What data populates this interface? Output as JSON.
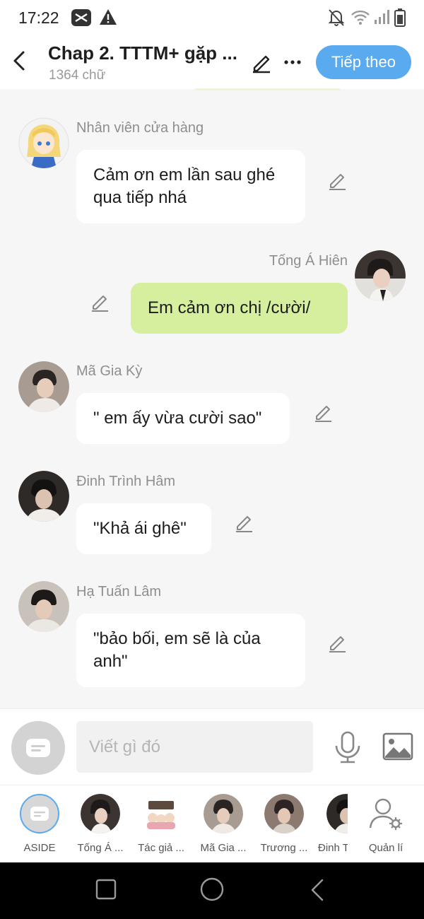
{
  "status_bar": {
    "time": "17:22",
    "icons": [
      "capcut-icon",
      "warning-icon",
      "bell-off-icon",
      "wifi-icon",
      "signal-icon",
      "battery-icon"
    ]
  },
  "header": {
    "title": "Chap 2. TTTM+ gặp ...",
    "word_count": "1364 chữ",
    "next_label": "Tiếp theo",
    "accent_color": "#5aaaf0"
  },
  "messages": [
    {
      "sender": "Nhân viên cửa hàng",
      "text": "Cảm ơn em lần sau ghé qua tiếp nhá",
      "side": "left"
    },
    {
      "sender": "Tống Á Hiên",
      "text": "Em cảm ơn chị /cười/",
      "side": "right"
    },
    {
      "sender": "Mã Gia Kỳ",
      "text": "\" em ấy vừa cười sao\"",
      "side": "left"
    },
    {
      "sender": "Đinh Trình Hâm",
      "text": "\"Khả ái ghê\"",
      "side": "left"
    },
    {
      "sender": "Hạ Tuấn Lâm",
      "text": "\"bảo bối, em sẽ là của anh\"",
      "side": "left"
    }
  ],
  "composer": {
    "placeholder": "Viết gì đó"
  },
  "characters": [
    {
      "label": "ASIDE"
    },
    {
      "label": "Tống Á ..."
    },
    {
      "label": "Tác giả ..."
    },
    {
      "label": "Mã Gia ..."
    },
    {
      "label": "Trương ..."
    },
    {
      "label": "Đinh T"
    },
    {
      "label": "Quản lí"
    }
  ],
  "colors": {
    "my_bubble": "#d5ef9f",
    "other_bubble": "#ffffff",
    "background": "#f6f6f6"
  }
}
